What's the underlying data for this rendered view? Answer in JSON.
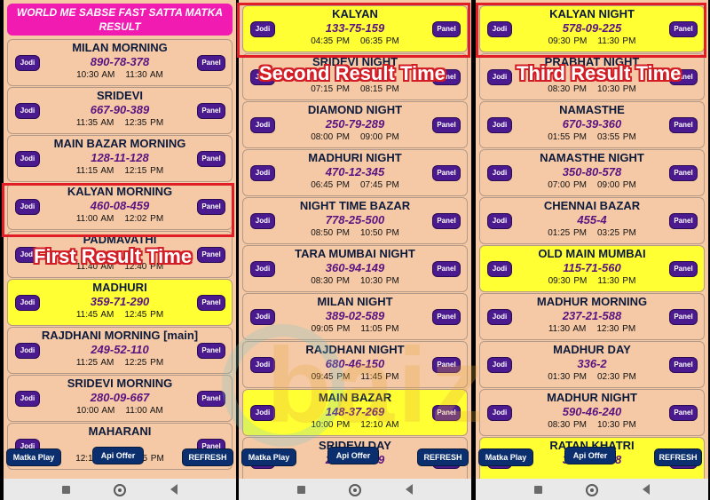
{
  "header": {
    "title": "WORLD ME SABSE FAST SATTA MATKA RESULT"
  },
  "buttons": {
    "jodi": "Jodi",
    "panel": "Panel",
    "matka_play": "Matka Play",
    "api_offer": "Api Offer",
    "refresh": "REFRESH"
  },
  "labels": {
    "first": "First Result Time",
    "second": "Second Result Time",
    "third": "Third Result Time"
  },
  "watermark": "baiz",
  "phone1": [
    {
      "name": "MILAN MORNING",
      "result": "890-78-378",
      "open": "10:30 AM",
      "close": "11:30 AM",
      "highlight": false
    },
    {
      "name": "SRIDEVI",
      "result": "667-90-389",
      "open": "11:35 AM",
      "close": "12:35 PM",
      "highlight": false
    },
    {
      "name": "MAIN BAZAR MORNING",
      "result": "128-11-128",
      "open": "11:15 AM",
      "close": "12:15 PM",
      "highlight": false
    },
    {
      "name": "KALYAN MORNING",
      "result": "460-08-459",
      "open": "11:00 AM",
      "close": "12:02 PM",
      "highlight": false
    },
    {
      "name": "PADMAVATHI",
      "result": "",
      "open": "11:40 AM",
      "close": "12:40 PM",
      "highlight": false
    },
    {
      "name": "MADHURI",
      "result": "359-71-290",
      "open": "11:45 AM",
      "close": "12:45 PM",
      "highlight": true
    },
    {
      "name": "RAJDHANI MORNING [main]",
      "result": "249-52-110",
      "open": "11:25 AM",
      "close": "12:25 PM",
      "highlight": false
    },
    {
      "name": "SRIDEVI MORNING",
      "result": "280-09-667",
      "open": "10:00 AM",
      "close": "11:00 AM",
      "highlight": false
    },
    {
      "name": "MAHARANI",
      "result": "",
      "open": "12:15 PM",
      "close": "02:15 PM",
      "highlight": false
    }
  ],
  "phone2": [
    {
      "name": "KALYAN",
      "result": "133-75-159",
      "open": "04:35 PM",
      "close": "06:35 PM",
      "highlight": true
    },
    {
      "name": "SRIDEVI NIGHT",
      "result": "",
      "open": "07:15 PM",
      "close": "08:15 PM",
      "highlight": false
    },
    {
      "name": "DIAMOND NIGHT",
      "result": "250-79-289",
      "open": "08:00 PM",
      "close": "09:00 PM",
      "highlight": false
    },
    {
      "name": "MADHURI NIGHT",
      "result": "470-12-345",
      "open": "06:45 PM",
      "close": "07:45 PM",
      "highlight": false
    },
    {
      "name": "NIGHT TIME BAZAR",
      "result": "778-25-500",
      "open": "08:50 PM",
      "close": "10:50 PM",
      "highlight": false
    },
    {
      "name": "TARA MUMBAI NIGHT",
      "result": "360-94-149",
      "open": "08:30 PM",
      "close": "10:30 PM",
      "highlight": false
    },
    {
      "name": "MILAN NIGHT",
      "result": "389-02-589",
      "open": "09:05 PM",
      "close": "11:05 PM",
      "highlight": false
    },
    {
      "name": "RAJDHANI NIGHT",
      "result": "680-46-150",
      "open": "09:45 PM",
      "close": "11:45 PM",
      "highlight": false
    },
    {
      "name": "MAIN BAZAR",
      "result": "148-37-269",
      "open": "10:00 PM",
      "close": "12:10 AM",
      "highlight": true
    },
    {
      "name": "SRIDEVI DAY",
      "result": "260-49-289",
      "open": "",
      "close": "",
      "highlight": false
    }
  ],
  "phone3": [
    {
      "name": "KALYAN NIGHT",
      "result": "578-09-225",
      "open": "09:30 PM",
      "close": "11:30 PM",
      "highlight": true
    },
    {
      "name": "PRABHAT NIGHT",
      "result": "",
      "open": "08:30 PM",
      "close": "10:30 PM",
      "highlight": false
    },
    {
      "name": "NAMASTHE",
      "result": "670-39-360",
      "open": "01:55 PM",
      "close": "03:55 PM",
      "highlight": false
    },
    {
      "name": "NAMASTHE NIGHT",
      "result": "350-80-578",
      "open": "07:00 PM",
      "close": "09:00 PM",
      "highlight": false
    },
    {
      "name": "CHENNAI BAZAR",
      "result": "455-4",
      "open": "01:25 PM",
      "close": "03:25 PM",
      "highlight": false
    },
    {
      "name": "OLD MAIN MUMBAI",
      "result": "115-71-560",
      "open": "09:30 PM",
      "close": "11:30 PM",
      "highlight": true
    },
    {
      "name": "MADHUR MORNING",
      "result": "237-21-588",
      "open": "11:30 AM",
      "close": "12:30 PM",
      "highlight": false
    },
    {
      "name": "MADHUR DAY",
      "result": "336-2",
      "open": "01:30 PM",
      "close": "02:30 PM",
      "highlight": false
    },
    {
      "name": "MADHUR NIGHT",
      "result": "590-46-240",
      "open": "08:30 PM",
      "close": "10:30 PM",
      "highlight": false
    },
    {
      "name": "RATAN KHATRI",
      "result": "349-07-278",
      "open": "",
      "close": "",
      "highlight": true
    }
  ]
}
